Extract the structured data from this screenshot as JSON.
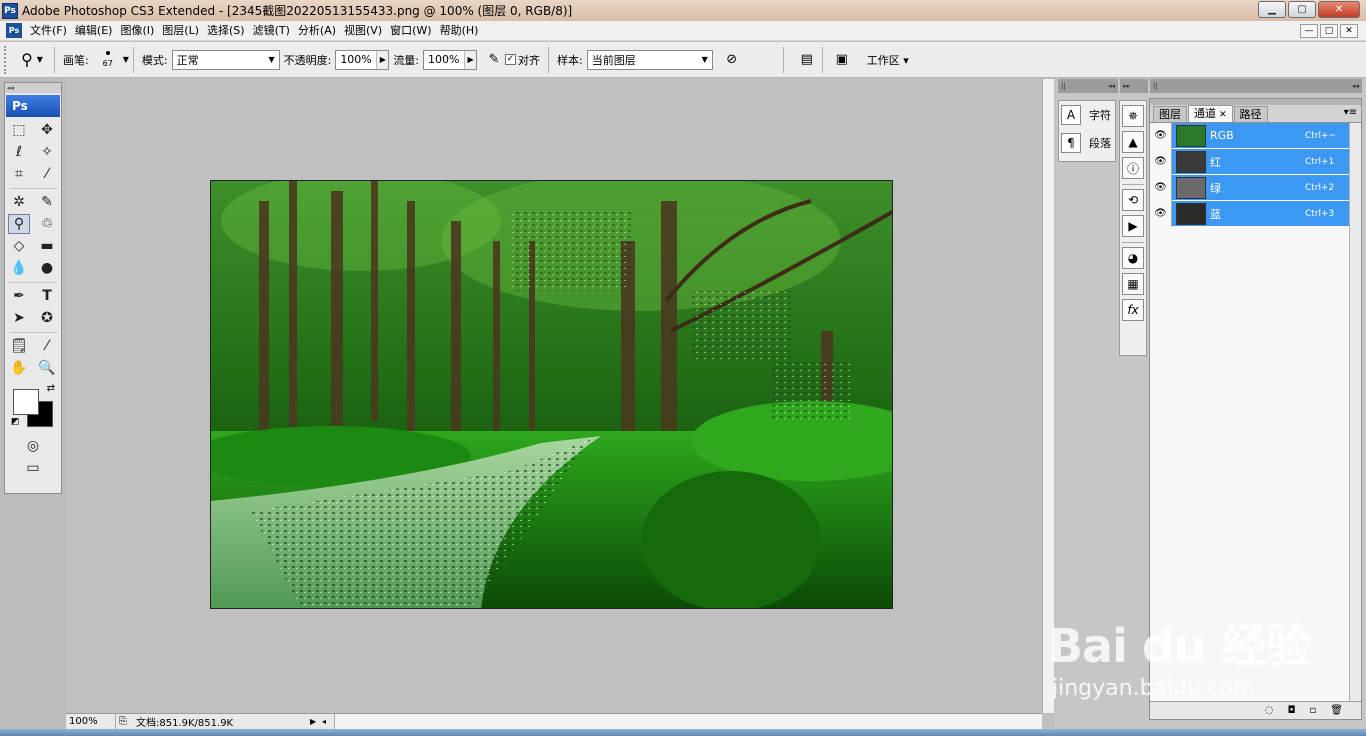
{
  "window": {
    "title": "Adobe Photoshop CS3 Extended - [2345截图20220513155433.png @ 100% (图层 0, RGB/8)]",
    "app_badge": "Ps",
    "min": "▁",
    "max": "▢",
    "close": "✕"
  },
  "menu": {
    "items": [
      "文件(F)",
      "编辑(E)",
      "图像(I)",
      "图层(L)",
      "选择(S)",
      "滤镜(T)",
      "分析(A)",
      "视图(V)",
      "窗口(W)",
      "帮助(H)"
    ],
    "doc_buttons": [
      "—",
      "▢",
      "✕"
    ]
  },
  "options": {
    "brush_label": "画笔:",
    "brush_size": "67",
    "mode_label": "模式:",
    "mode_value": "正常",
    "opacity_label": "不透明度:",
    "opacity_value": "100%",
    "flow_label": "流量:",
    "flow_value": "100%",
    "align_label": "对齐",
    "align_checked": "✓",
    "sample_label": "样本:",
    "sample_value": "当前图层",
    "workspace_label": "工作区 ▾"
  },
  "toolbox": {
    "badge": "Ps",
    "active_tool": "clone-stamp-tool"
  },
  "status": {
    "zoom": "100%",
    "doc_info": "文档:851.9K/851.9K"
  },
  "character_panel": {
    "items": [
      {
        "icon": "A",
        "label": "字符"
      },
      {
        "icon": "¶",
        "label": "段落"
      }
    ]
  },
  "channels": {
    "tabs": [
      "图层",
      "通道",
      "路径"
    ],
    "active_tab": "通道",
    "rows": [
      {
        "name": "RGB",
        "shortcut": "Ctrl+~",
        "thumb_color": "#2a7a2a"
      },
      {
        "name": "红",
        "shortcut": "Ctrl+1",
        "thumb_color": "#3a3a3a"
      },
      {
        "name": "绿",
        "shortcut": "Ctrl+2",
        "thumb_color": "#6a6a6a"
      },
      {
        "name": "蓝",
        "shortcut": "Ctrl+3",
        "thumb_color": "#2b2b2b"
      }
    ],
    "selected_color": "#3c98f2"
  },
  "watermark": {
    "logo": "Bai du 经验",
    "url": "jingyan.baidu.com"
  }
}
